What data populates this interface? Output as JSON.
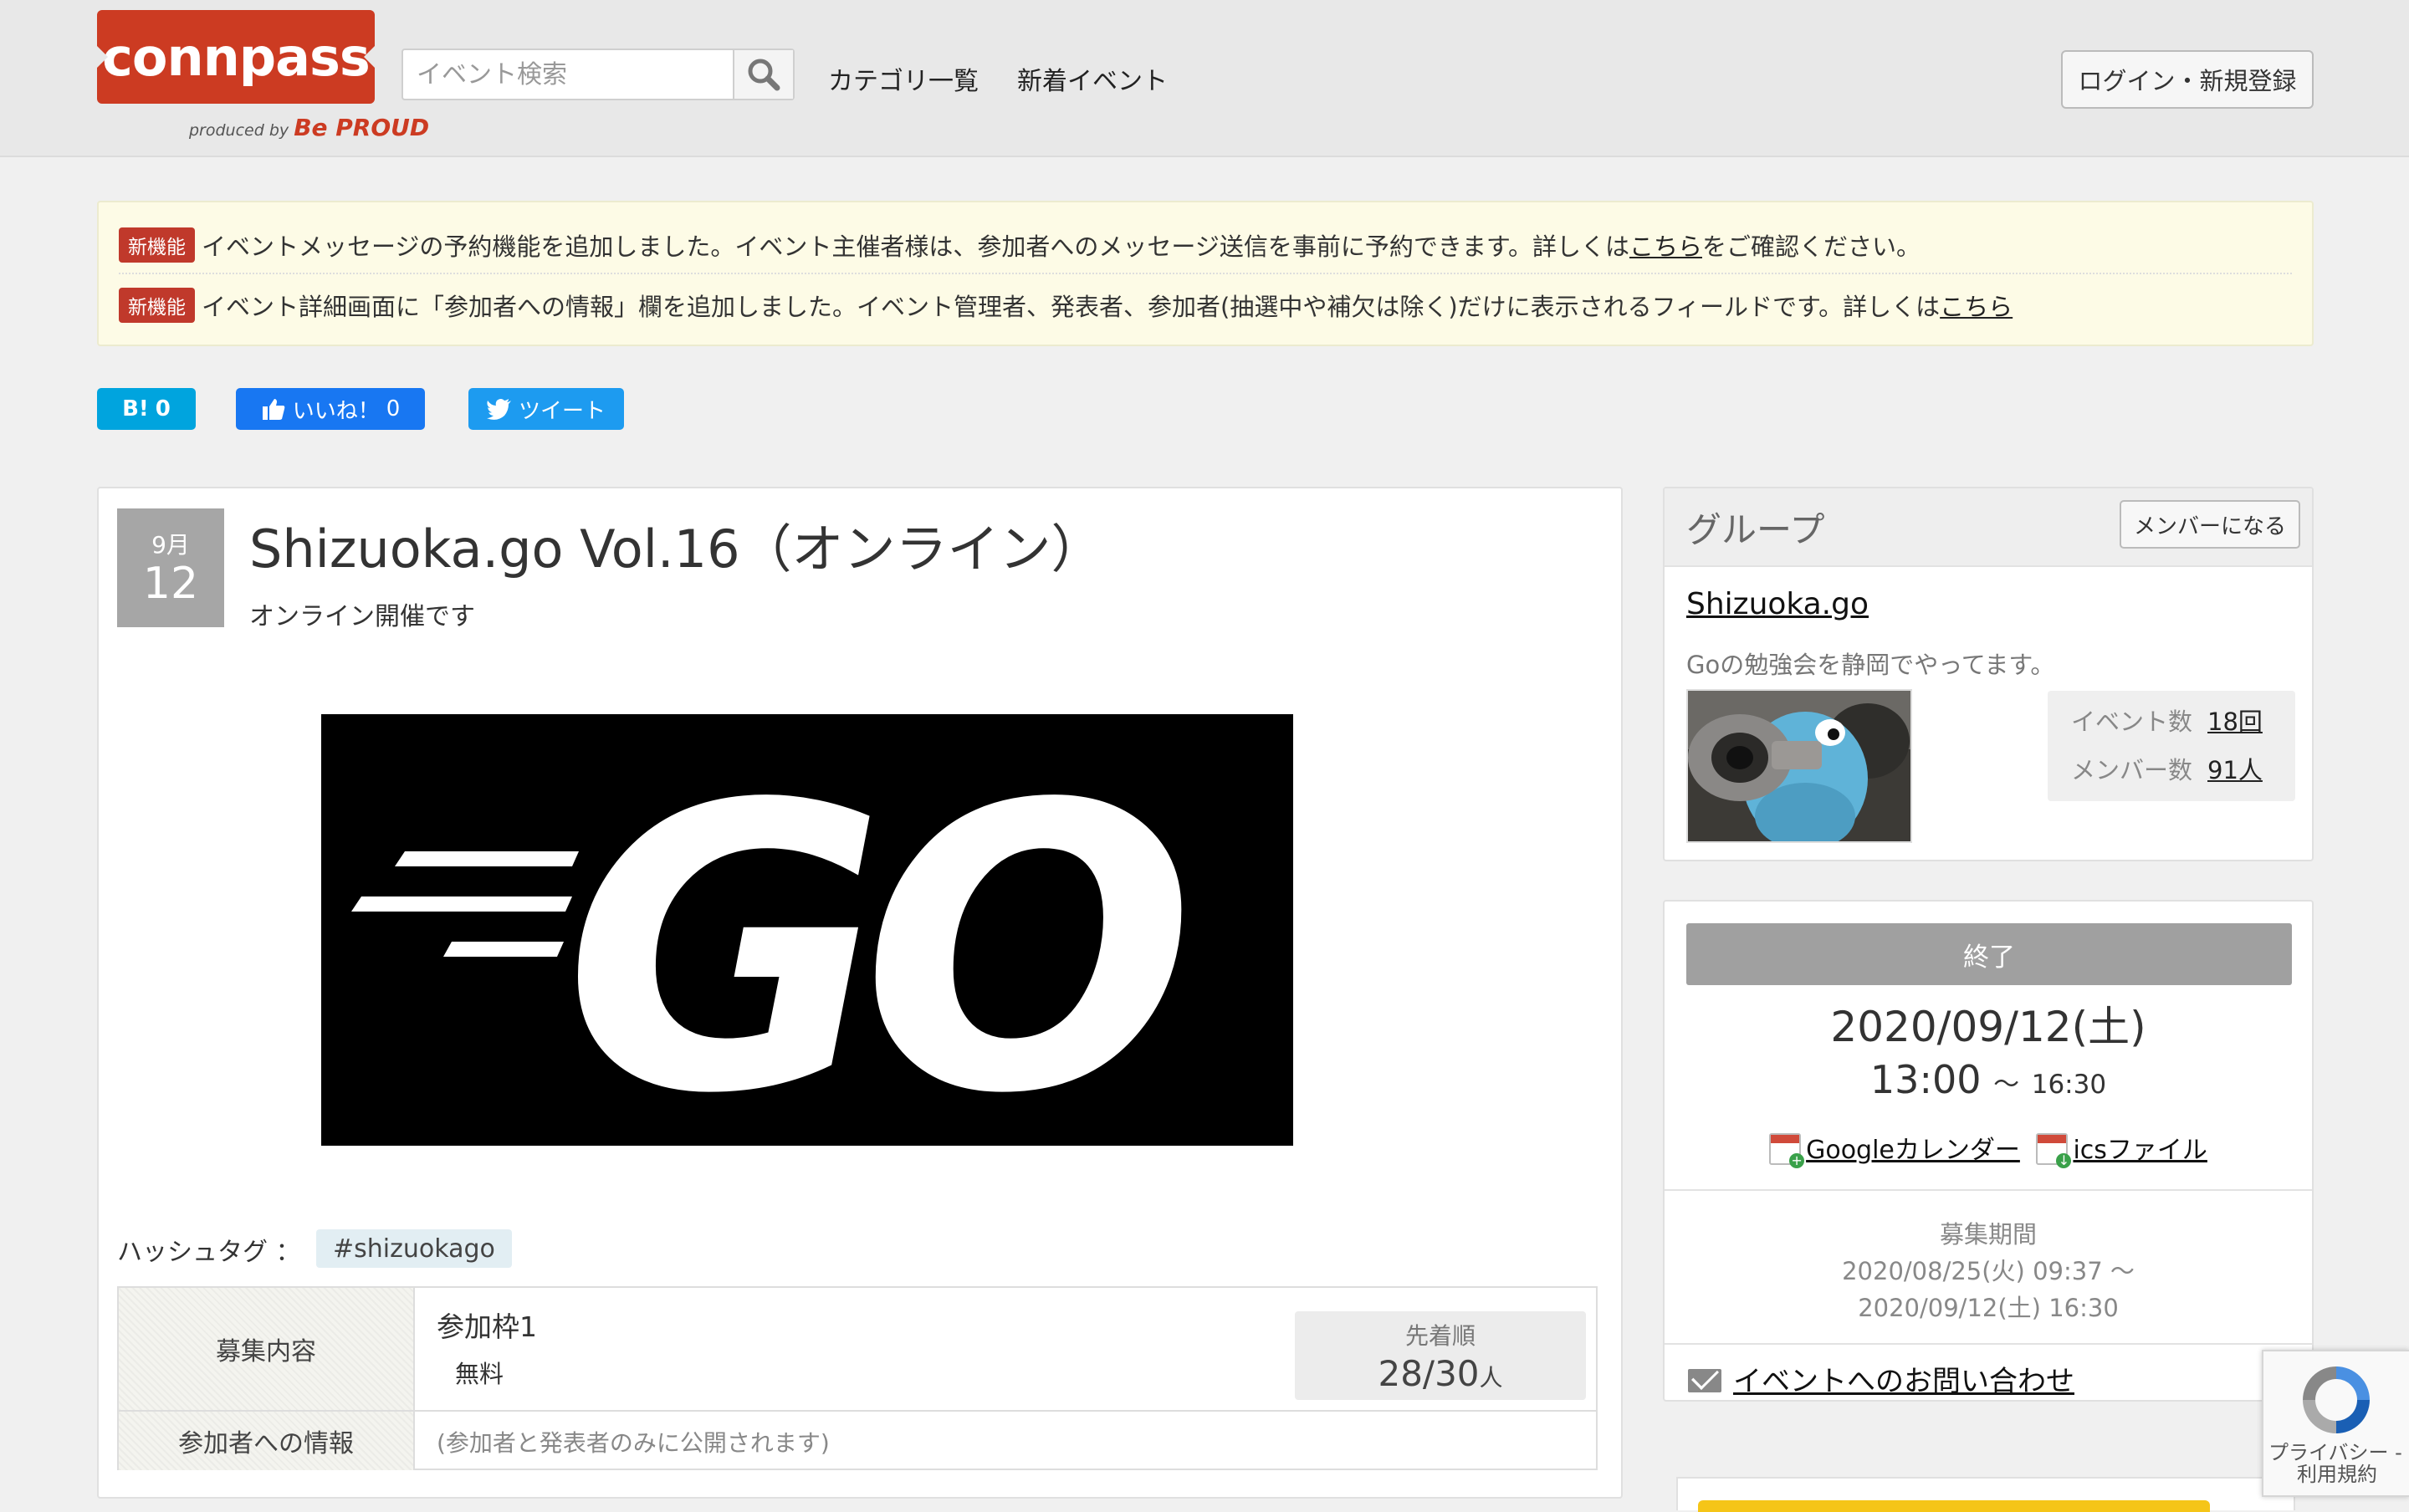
{
  "header": {
    "logo_text": "connpass",
    "produced_by": "produced by",
    "produced_brand": "Be PROUD",
    "search_placeholder": "イベント検索",
    "nav": [
      "カテゴリ一覧",
      "新着イベント"
    ],
    "login_label": "ログイン・新規登録"
  },
  "notices": [
    {
      "badge": "新機能",
      "text": "イベントメッセージの予約機能を追加しました。イベント主催者様は、参加者へのメッセージ送信を事前に予約できます。詳しくは",
      "link": "こちら",
      "suffix": "をご確認ください。"
    },
    {
      "badge": "新機能",
      "text": "イベント詳細画面に「参加者への情報」欄を追加しました。イベント管理者、発表者、参加者(抽選中や補欠は除く)だけに表示されるフィールドです。詳しくは",
      "link": "こちら",
      "suffix": ""
    }
  ],
  "social": {
    "hatena_label": "B!",
    "hatena_count": "0",
    "facebook_label": "いいね！",
    "facebook_count": "0",
    "twitter_label": "ツイート"
  },
  "event": {
    "month": "9月",
    "day": "12",
    "title": "Shizuoka.go Vol.16（オンライン）",
    "subtitle": "オンライン開催です",
    "image_text": "GO",
    "hashtag_label": "ハッシュタグ ：",
    "hashtag": "#shizuokago",
    "recruit_label": "募集内容",
    "participant_frame": "参加枠1",
    "fee": "無料",
    "order_label": "先着順",
    "count": "28/30",
    "count_unit": "人",
    "info_label": "参加者への情報",
    "info_note": "(参加者と発表者のみに公開されます)"
  },
  "group": {
    "title": "グループ",
    "member_button": "メンバーになる",
    "name": "Shizuoka.go",
    "description": "Goの勉強会を静岡でやってます。",
    "events_label": "イベント数",
    "events_value": "18回",
    "members_label": "メンバー数",
    "members_value": "91人"
  },
  "schedule": {
    "status": "終了",
    "date": "2020/09/12(土)",
    "start": "13:00",
    "separator": "～",
    "end": "16:30",
    "google_calendar": "Googleカレンダー",
    "ics_file": "icsファイル",
    "period_label": "募集期間",
    "period_start": "2020/08/25(火) 09:37 ～",
    "period_end": "2020/09/12(土) 16:30",
    "contact": "イベントへのお問い合わせ"
  },
  "recaptcha": {
    "privacy": "プライバシー -",
    "terms": "利用規約"
  },
  "colors": {
    "brand": "#cc3b22",
    "hatena": "#00a4de",
    "facebook": "#1877f2",
    "twitter": "#1da1f2"
  }
}
